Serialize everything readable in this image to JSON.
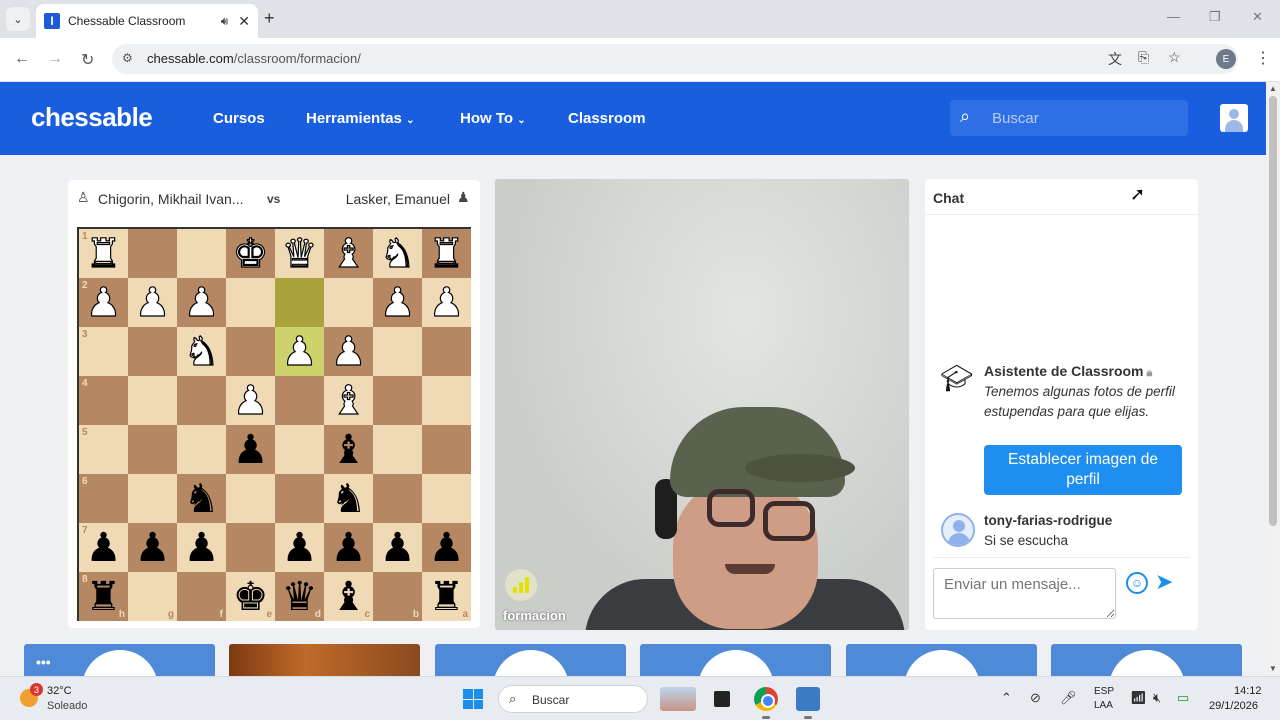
{
  "browser": {
    "tab_title": "Chessable Classroom",
    "favicon_letter": "I",
    "url_domain": "chessable.com",
    "url_path": "/classroom/formacion/",
    "profile_letter": "E"
  },
  "header": {
    "logo": "chessable",
    "nav": [
      "Cursos",
      "Herramientas",
      "How To",
      "Classroom"
    ],
    "search_placeholder": "Buscar"
  },
  "game": {
    "white_player": "Chigorin, Mikhail Ivan...",
    "vs": "vs",
    "black_player": "Lasker, Emanuel",
    "ranks": [
      "1",
      "2",
      "3",
      "4",
      "5",
      "6",
      "7",
      "8"
    ],
    "files": [
      "h",
      "g",
      "f",
      "e",
      "d",
      "c",
      "b",
      "a"
    ],
    "board": [
      [
        "wR",
        "",
        "",
        "wK",
        "wQ",
        "wB",
        "wN",
        "wR"
      ],
      [
        "wP",
        "wP",
        "wP",
        "",
        "",
        "",
        "wP",
        "wP"
      ],
      [
        "",
        "",
        "wN",
        "",
        "wP",
        "wP",
        "",
        ""
      ],
      [
        "",
        "",
        "",
        "wP",
        "",
        "wB",
        "",
        ""
      ],
      [
        "",
        "",
        "",
        "bP",
        "",
        "bB",
        "",
        ""
      ],
      [
        "",
        "",
        "bN",
        "",
        "",
        "bN",
        "",
        ""
      ],
      [
        "bP",
        "bP",
        "bP",
        "",
        "bP",
        "bP",
        "bP",
        "bP"
      ],
      [
        "bR",
        "",
        "",
        "bK",
        "bQ",
        "bB",
        "",
        "bR"
      ]
    ],
    "highlighted_squares": [
      [
        1,
        4
      ],
      [
        2,
        4
      ]
    ]
  },
  "video": {
    "participant_label": "formacion"
  },
  "chat": {
    "title": "Chat",
    "bot_name": "Asistente de Classroom",
    "bot_message": "Tenemos algunas fotos de perfil estupendas para que elijas.",
    "cta_label": "Establecer imagen de perfil",
    "message_user": "tony-farias-rodrigue",
    "message_text": "Si se escucha",
    "input_placeholder": "Enviar un mensaje..."
  },
  "thumbnails": {
    "more_label": "•••"
  },
  "taskbar": {
    "temperature": "32°C",
    "condition": "Soleado",
    "weather_badge": "3",
    "search_label": "Buscar",
    "lang_primary": "ESP",
    "lang_secondary": "LAA",
    "time": "14:12",
    "date": "29/1/2026"
  },
  "colors": {
    "brand_blue": "#1a5ee0",
    "accent_blue": "#1e8ff0",
    "board_light": "#f0d9b5",
    "board_dark": "#b58863"
  }
}
